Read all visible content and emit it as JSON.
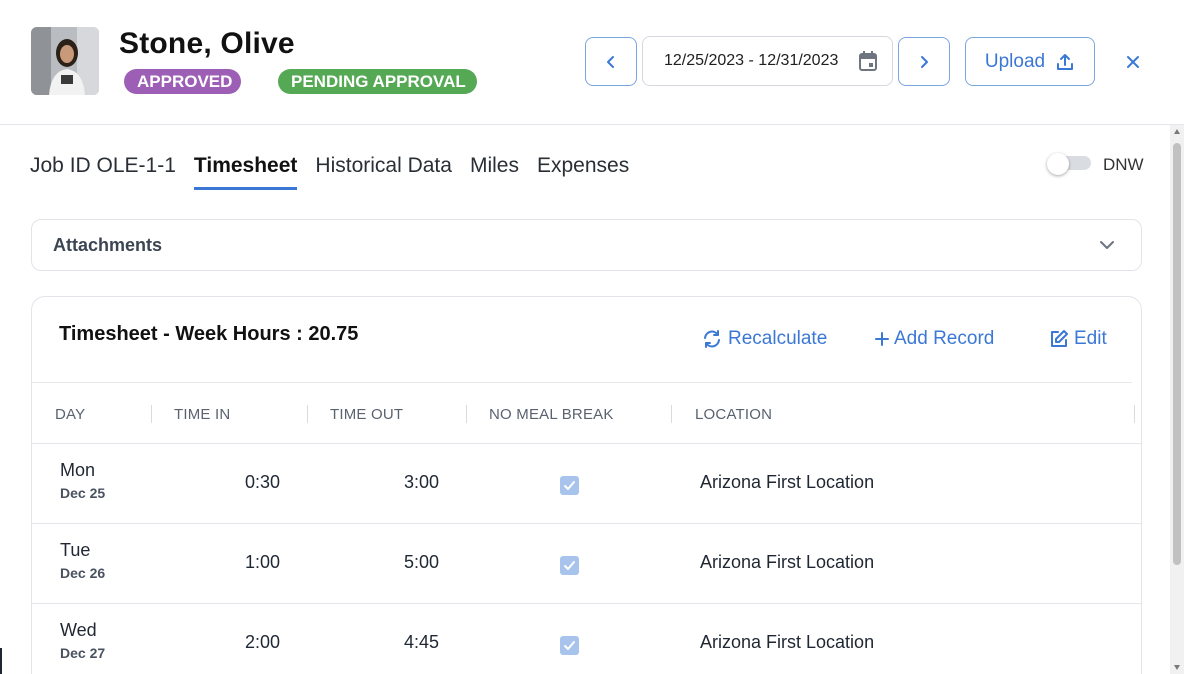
{
  "header": {
    "employee_name": "Stone, Olive",
    "badges": [
      "APPROVED",
      "PENDING APPROVAL"
    ],
    "date_range": "12/25/2023 - 12/31/2023",
    "upload_label": "Upload"
  },
  "tabs": [
    {
      "label": "Job ID OLE-1-1",
      "active": false
    },
    {
      "label": "Timesheet",
      "active": true
    },
    {
      "label": "Historical Data",
      "active": false
    },
    {
      "label": "Miles",
      "active": false
    },
    {
      "label": "Expenses",
      "active": false
    }
  ],
  "toggle": {
    "label": "DNW",
    "on": false
  },
  "attachments": {
    "title": "Attachments"
  },
  "timesheet": {
    "title": "Timesheet - Week Hours : 20.75",
    "actions": {
      "recalculate": "Recalculate",
      "add_record": "Add Record",
      "edit": "Edit"
    },
    "columns": [
      "DAY",
      "TIME IN",
      "TIME OUT",
      "NO MEAL BREAK",
      "LOCATION"
    ],
    "rows": [
      {
        "day": "Mon",
        "date": "Dec 25",
        "time_in": "0:30",
        "time_out": "3:00",
        "no_meal_break": true,
        "location": "Arizona First Location"
      },
      {
        "day": "Tue",
        "date": "Dec 26",
        "time_in": "1:00",
        "time_out": "5:00",
        "no_meal_break": true,
        "location": "Arizona First Location"
      },
      {
        "day": "Wed",
        "date": "Dec 27",
        "time_in": "2:00",
        "time_out": "4:45",
        "no_meal_break": true,
        "location": "Arizona First Location"
      }
    ]
  },
  "colors": {
    "accent": "#3b78d6",
    "approved_badge": "#9c5fb5",
    "pending_badge": "#55a854",
    "checkbox": "#a8c4ec"
  },
  "icons": [
    "chevron-left-icon",
    "calendar-icon",
    "chevron-right-icon",
    "upload-icon",
    "close-icon",
    "chevron-down-icon",
    "refresh-icon",
    "plus-icon",
    "edit-icon",
    "check-icon"
  ]
}
